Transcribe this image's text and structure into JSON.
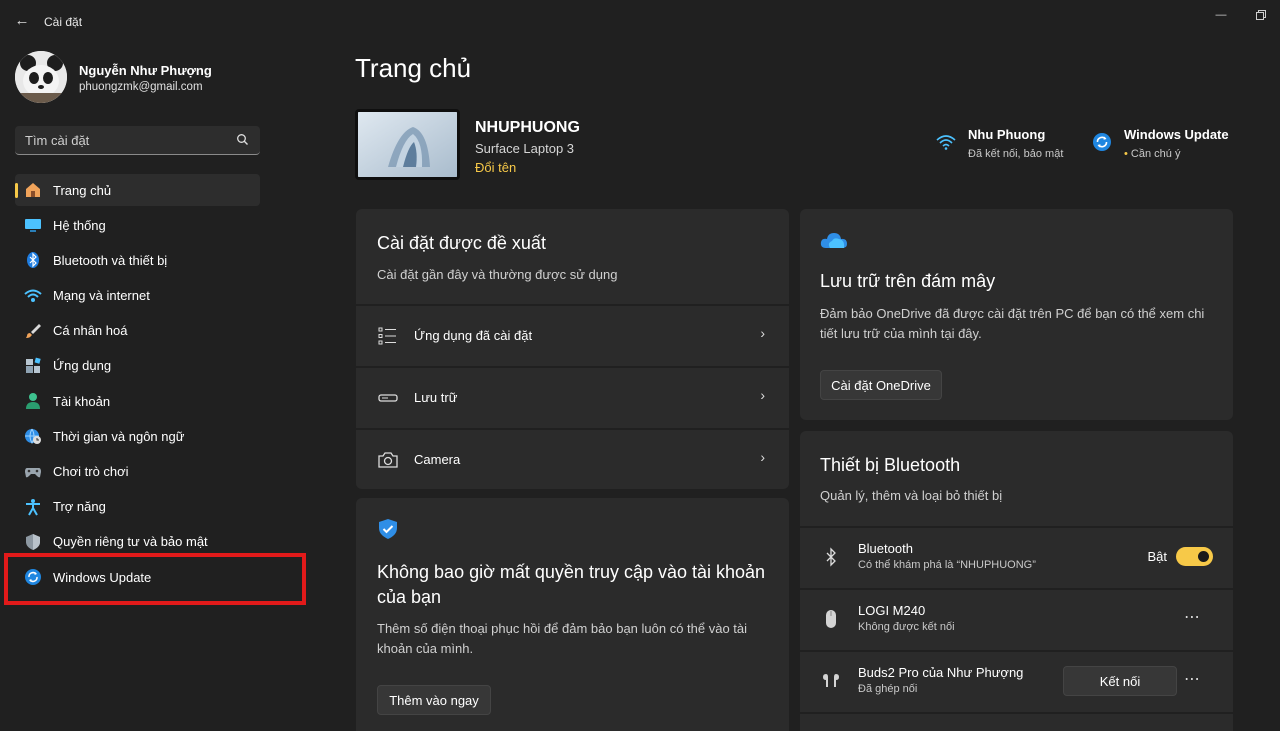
{
  "window": {
    "title": "Cài đặt"
  },
  "profile": {
    "name": "Nguyễn Như Phượng",
    "email": "phuongzmk@gmail.com"
  },
  "search": {
    "placeholder": "Tìm cài đặt"
  },
  "nav": {
    "items": [
      {
        "label": "Trang chủ",
        "icon": "home-icon"
      },
      {
        "label": "Hệ thống",
        "icon": "system-icon"
      },
      {
        "label": "Bluetooth và thiết bị",
        "icon": "bluetooth-icon"
      },
      {
        "label": "Mạng và internet",
        "icon": "wifi-icon"
      },
      {
        "label": "Cá nhân hoá",
        "icon": "brush-icon"
      },
      {
        "label": "Ứng dụng",
        "icon": "apps-icon"
      },
      {
        "label": "Tài khoản",
        "icon": "person-icon"
      },
      {
        "label": "Thời gian và ngôn ngữ",
        "icon": "globe-clock-icon"
      },
      {
        "label": "Chơi trò chơi",
        "icon": "gamepad-icon"
      },
      {
        "label": "Trợ năng",
        "icon": "accessibility-icon"
      },
      {
        "label": "Quyền riêng tư và bảo mật",
        "icon": "shield-icon"
      },
      {
        "label": "Windows Update",
        "icon": "update-icon"
      }
    ]
  },
  "main": {
    "title": "Trang chủ",
    "device": {
      "name": "NHUPHUONG",
      "model": "Surface Laptop 3",
      "rename": "Đổi tên"
    },
    "status": {
      "network": {
        "title": "Nhu Phuong",
        "sub": "Đã kết nối, bảo mật"
      },
      "update": {
        "title": "Windows Update",
        "sub": "Cần chú ý"
      }
    },
    "recommended": {
      "title": "Cài đặt được đề xuất",
      "sub": "Cài đặt gần đây và thường được sử dụng",
      "rows": [
        {
          "label": "Ứng dụng đã cài đặt",
          "icon": "list-icon"
        },
        {
          "label": "Lưu trữ",
          "icon": "storage-icon"
        },
        {
          "label": "Camera",
          "icon": "camera-icon"
        }
      ]
    },
    "account": {
      "title": "Không bao giờ mất quyền truy cập vào tài khoản của bạn",
      "sub": "Thêm số điện thoại phục hồi để đảm bảo bạn luôn có thể vào tài khoản của mình.",
      "button": "Thêm vào ngay"
    },
    "cloud": {
      "title": "Lưu trữ trên đám mây",
      "sub": "Đảm bảo OneDrive đã được cài đặt trên PC để bạn có thể xem chi tiết lưu trữ của mình tại đây.",
      "button": "Cài đặt OneDrive"
    },
    "bluetooth": {
      "title": "Thiết bị Bluetooth",
      "sub": "Quản lý, thêm và loại bỏ thiết bị",
      "toggle": {
        "name": "Bluetooth",
        "sub": "Có thể khám phá là “NHUPHUONG”",
        "state": "Bật"
      },
      "devices": [
        {
          "name": "LOGI M240",
          "sub": "Không được kết nối"
        },
        {
          "name": "Buds2 Pro của Như Phượng",
          "sub": "Đã ghép nối",
          "button": "Kết nối"
        }
      ]
    }
  },
  "colors": {
    "accent": "#f7c948",
    "background": "#202020",
    "card": "#2b2b2b",
    "highlight": "#e21a1a"
  }
}
